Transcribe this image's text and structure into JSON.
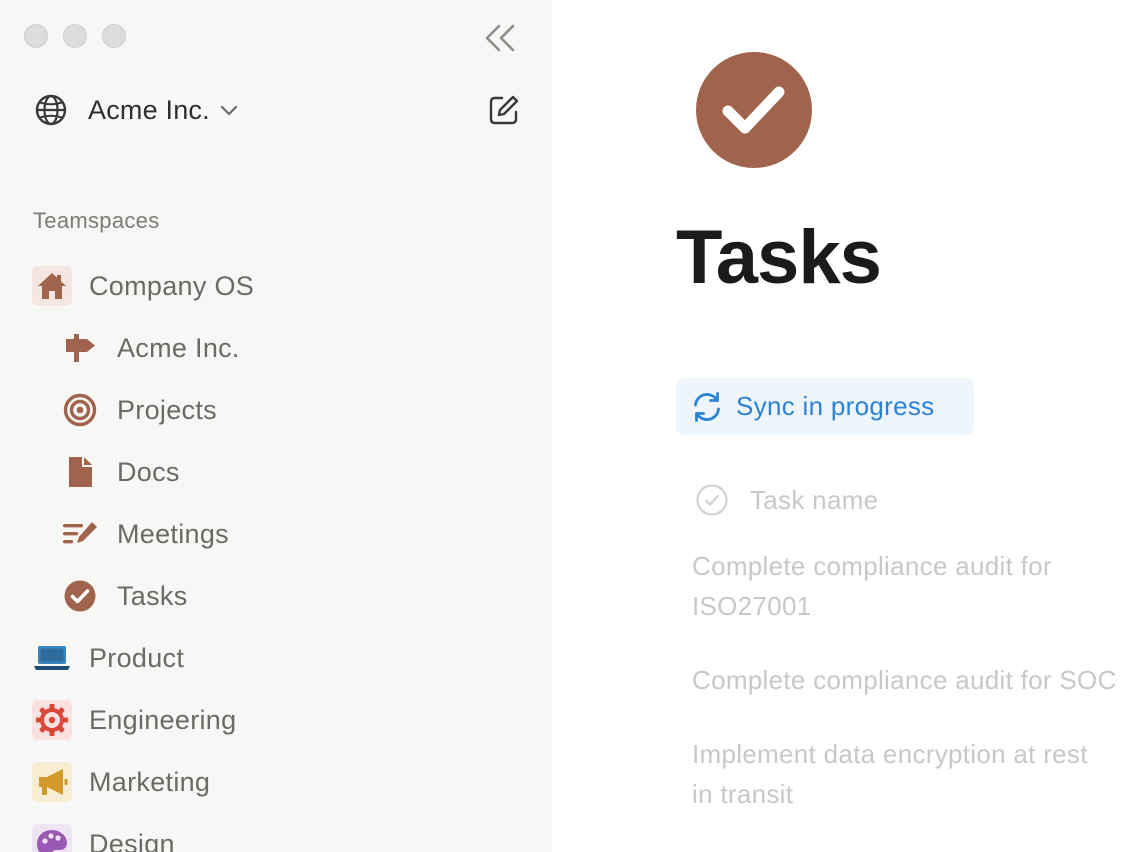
{
  "sidebar": {
    "workspace_name": "Acme Inc.",
    "section_label": "Teamspaces",
    "items": [
      {
        "label": "Company OS",
        "icon": "house-icon",
        "level": 0
      },
      {
        "label": "Acme Inc.",
        "icon": "signpost-icon",
        "level": 1
      },
      {
        "label": "Projects",
        "icon": "target-icon",
        "level": 1
      },
      {
        "label": "Docs",
        "icon": "document-icon",
        "level": 1
      },
      {
        "label": "Meetings",
        "icon": "notes-pencil-icon",
        "level": 1
      },
      {
        "label": "Tasks",
        "icon": "check-circle-icon",
        "level": 1
      },
      {
        "label": "Product",
        "icon": "laptop-icon",
        "level": 0
      },
      {
        "label": "Engineering",
        "icon": "gear-icon",
        "level": 0
      },
      {
        "label": "Marketing",
        "icon": "megaphone-icon",
        "level": 0
      },
      {
        "label": "Design",
        "icon": "palette-icon",
        "level": 0
      }
    ]
  },
  "main": {
    "title": "Tasks",
    "sync_status": "Sync in progress",
    "column_header": "Task name",
    "tasks": [
      {
        "line1": "Complete compliance audit for",
        "line2": "ISO27001"
      },
      {
        "line1": "Complete compliance audit for SOC",
        "line2": ""
      },
      {
        "line1": "Implement data encryption at rest",
        "line2": "in transit"
      }
    ]
  },
  "colors": {
    "brand_brown": "#a0634c",
    "sync_blue": "#2c83d6",
    "sidebar_bg": "#f7f7f5"
  }
}
